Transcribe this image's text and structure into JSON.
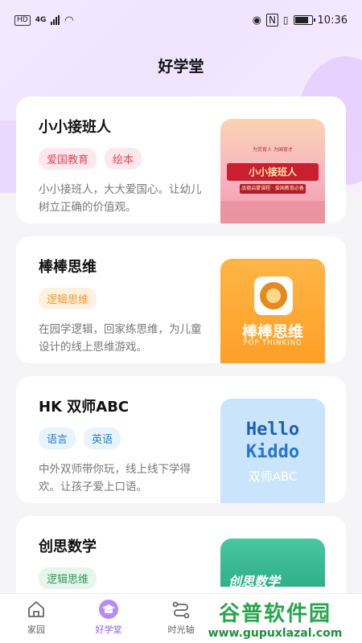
{
  "status_bar": {
    "left_badges": [
      "HD",
      "4G"
    ],
    "time": "10:36"
  },
  "header": {
    "title": "好学堂"
  },
  "cards": [
    {
      "title": "小小接班人",
      "tags": [
        "爱国教育",
        "绘本"
      ],
      "description": "小小接班人，大大爱国心。让幼儿树立正确的价值观。",
      "thumb": {
        "subtitle": "为党育人 为国育才",
        "title": "小小接班人",
        "tagline": "品德启蒙课程 · 爱国教育必备"
      }
    },
    {
      "title": "棒棒思维",
      "tags": [
        "逻辑思维"
      ],
      "description": "在园学逻辑，回家练思维，为儿童设计的线上思维游戏。",
      "thumb": {
        "title": "棒棒思维",
        "subtitle": "POP THINKING"
      }
    },
    {
      "title": "HK 双师ABC",
      "tags": [
        "语言",
        "英语"
      ],
      "description": "中外双师带你玩，线上线下学得欢。让孩子爱上口语。",
      "thumb": {
        "line1": "Hello",
        "line2": "Kiddo",
        "line3": "双师ABC"
      }
    },
    {
      "title": "创思数学",
      "tags": [
        "逻辑思维"
      ],
      "thumb": {
        "title": "创思数学"
      }
    }
  ],
  "tabbar": {
    "items": [
      {
        "label": "家园",
        "icon": "home-icon"
      },
      {
        "label": "好学堂",
        "icon": "graduation-cap-icon",
        "active": true
      },
      {
        "label": "时光轴",
        "icon": "timeline-icon"
      }
    ]
  },
  "watermark": {
    "line1": "谷普软件园",
    "line2": "www.gupuxlazal.com"
  },
  "colors": {
    "accent": "#8f5cf2",
    "tag_pink": "#e0485e",
    "tag_orange": "#f29a2e",
    "tag_blue": "#2b7fc7",
    "tag_green": "#2f9a5a"
  }
}
